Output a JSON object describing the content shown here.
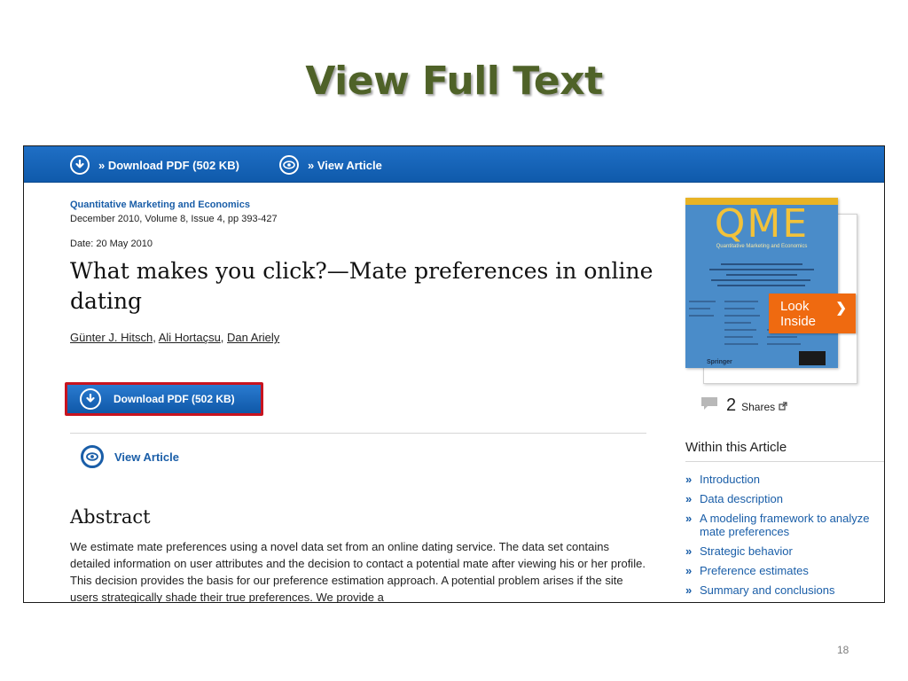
{
  "slide": {
    "title": "View Full Text",
    "page_number": "18"
  },
  "topbar": {
    "download_label": "» Download PDF (502 KB)",
    "view_label": "» View Article"
  },
  "article": {
    "journal": "Quantitative Marketing and Economics",
    "meta": "December 2010, Volume 8, Issue 4, pp 393-427",
    "date": "Date: 20 May 2010",
    "title": "What makes you click?—Mate preferences in online dating",
    "authors": [
      "Günter J. Hitsch",
      "Ali Hortaçsu",
      "Dan Ariely"
    ],
    "download_button": "Download PDF (502 KB)",
    "view_article": "View Article",
    "abstract_heading": "Abstract",
    "abstract_text": "We estimate mate preferences using a novel data set from an online dating service. The data set contains detailed information on user attributes and the decision to contact a potential mate after viewing his or her profile. This decision provides the basis for our preference estimation approach. A potential problem arises if the site users strategically shade their true preferences. We provide a"
  },
  "sidebar": {
    "cover_title": "QME",
    "cover_subtitle": "Quantitative Marketing and Economics",
    "cover_publisher": "Springer",
    "look_inside": "Look Inside",
    "shares_count": "2",
    "shares_label": "Shares",
    "within_heading": "Within this Article",
    "toc": [
      "Introduction",
      "Data description",
      "A modeling framework to analyze mate preferences",
      "Strategic behavior",
      "Preference estimates",
      "Summary and conclusions"
    ]
  },
  "colors": {
    "title_green": "#4f6228",
    "bar_blue": "#1465b8",
    "link_blue": "#1a5ea8",
    "highlight_red": "#c8141f",
    "look_inside_orange": "#ef6a10"
  }
}
